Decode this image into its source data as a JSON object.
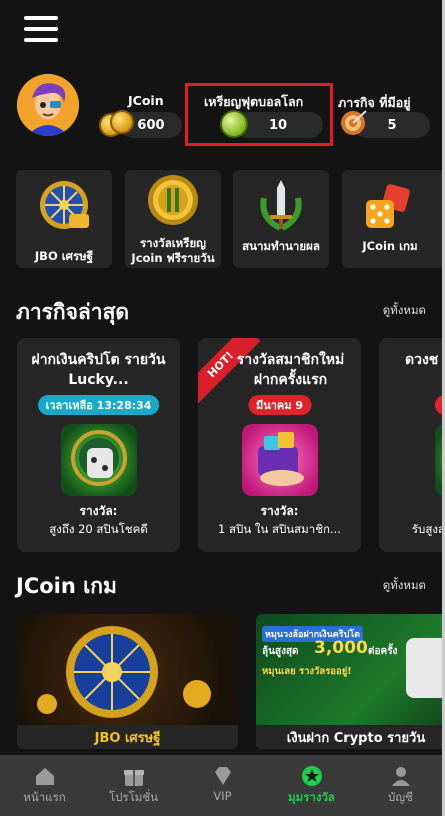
{
  "header": {
    "menu_icon": "hamburger-menu-icon",
    "avatar_icon": "user-avatar"
  },
  "stats": {
    "jcoin": {
      "label": "JCoin",
      "value": "600",
      "icon": "jcoin-stack-icon"
    },
    "football_coin": {
      "label": "เหรียญฟุตบอลโลก",
      "value": "10",
      "icon": "football-coin-icon"
    },
    "missions": {
      "label": "ภารกิจ ที่มีอยู่",
      "value": "5",
      "icon": "mission-target-icon"
    },
    "highlight_color": "#e11c24"
  },
  "shortcuts": [
    {
      "label": "JBO เศรษฐี",
      "icon": "fortune-wheel-icon"
    },
    {
      "label": "รางวัลเหรียญ Jcoin ฟรีรายวัน",
      "icon": "gold-coin-icon"
    },
    {
      "label": "สนามทำนายผล",
      "icon": "sword-laurel-icon"
    },
    {
      "label": "JCoin เกม",
      "icon": "dice-icon"
    }
  ],
  "missions_section": {
    "title": "ภารกิจล่าสุด",
    "see_all": "ดูทั้งหมด",
    "cards": [
      {
        "title": "ฝากเงินคริปโต รายวัน Lucky...",
        "badge": "เวลาเหลือ 13:28:34",
        "badge_color": "#1ba9c9",
        "reward_label": "รางวัล:",
        "reward_value": "สูงถึง 20 สปินโชคดี",
        "icon": "fortune-wheel-reward-icon"
      },
      {
        "title": "รางวัลสมาชิกใหม่ ฝากครั้งแรก",
        "badge": "มีนาคม 9",
        "badge_color": "#e0242c",
        "hot": "HOT!",
        "reward_label": "รางวัล:",
        "reward_value": "1 สปิน ใน สปินสมาชิก...",
        "icon": "wallet-gift-icon"
      },
      {
        "title": "ดวงช",
        "badge": "พฤ",
        "badge_color": "#e0242c",
        "reward_label": "",
        "reward_value": "รับสูงสุ",
        "icon": "partial-reward-icon"
      }
    ]
  },
  "games_section": {
    "title": "JCoin เกม",
    "see_all": "ดูทั้งหมด",
    "banners": [
      {
        "caption": "JBO เศรษฐี"
      },
      {
        "caption": "เงินฝาก Crypto รายวัน",
        "promo_line1": "หมุนวงล้อฝากเงินคริปโต",
        "promo_line2": "ลุ้นสูงสุด",
        "promo_amount": "3,000",
        "promo_unit": "ต่อครั้ง",
        "promo_line3": "หมุนเลย รางวัลรออยู่!"
      }
    ]
  },
  "bottom_nav": {
    "active_color": "#19d14a",
    "items": [
      {
        "label": "หน้าแรก",
        "icon": "home-icon",
        "active": false
      },
      {
        "label": "โปรโมชั่น",
        "icon": "gift-icon",
        "active": false
      },
      {
        "label": "VIP",
        "icon": "diamond-icon",
        "active": false
      },
      {
        "label": "มุมรางวัล",
        "icon": "star-icon",
        "active": true
      },
      {
        "label": "บัญชี",
        "icon": "account-icon",
        "active": false
      }
    ]
  }
}
